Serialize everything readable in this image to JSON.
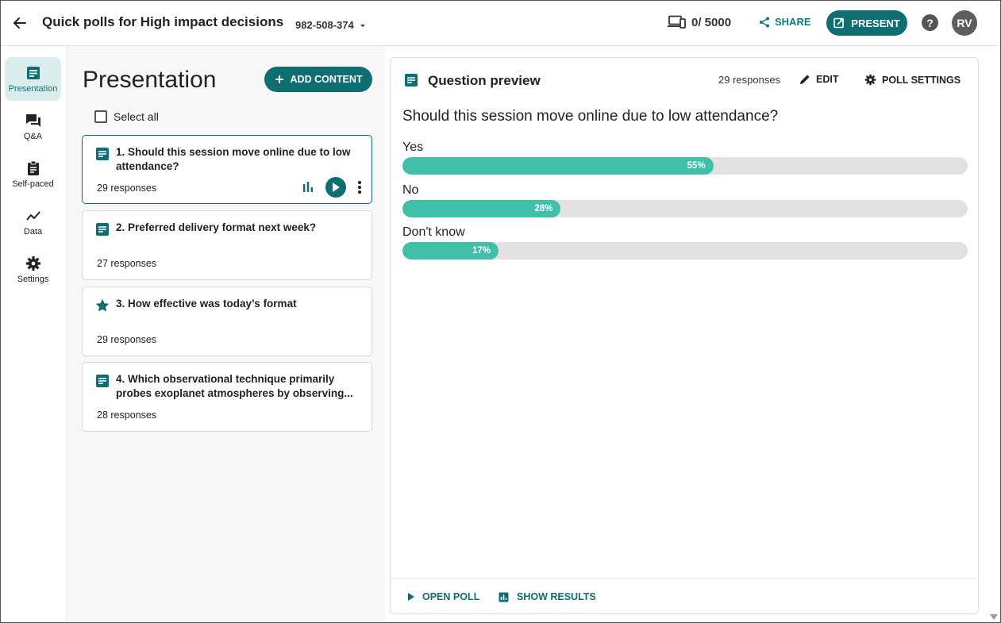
{
  "header": {
    "title": "Quick polls for High impact decisions",
    "session_id": "982-508-374",
    "participants": "0/ 5000",
    "share_label": "SHARE",
    "present_label": "PRESENT",
    "help_label": "?",
    "avatar_initials": "RV"
  },
  "nav": {
    "items": [
      {
        "label": "Presentation",
        "icon": "presentation-icon"
      },
      {
        "label": "Q&A",
        "icon": "chat-icon"
      },
      {
        "label": "Self-paced",
        "icon": "clipboard-icon"
      },
      {
        "label": "Data",
        "icon": "trend-icon"
      },
      {
        "label": "Settings",
        "icon": "gear-icon"
      }
    ]
  },
  "list": {
    "title": "Presentation",
    "add_label": "ADD CONTENT",
    "select_all_label": "Select all",
    "cards": [
      {
        "title": "1. Should this session move online due to low attendance?",
        "responses": "29 responses",
        "icon": "poll-icon"
      },
      {
        "title": "2. Preferred delivery format next week?",
        "responses": "27 responses",
        "icon": "poll-icon"
      },
      {
        "title": "3. How effective was today’s format",
        "responses": "29 responses",
        "icon": "star-icon"
      },
      {
        "title": "4. Which observational technique primarily probes exoplanet atmospheres by observing...",
        "responses": "28 responses",
        "icon": "poll-icon"
      }
    ]
  },
  "preview": {
    "title": "Question preview",
    "responses": "29 responses",
    "edit_label": "EDIT",
    "settings_label": "POLL SETTINGS",
    "question": "Should this session move online due to low attendance?",
    "options": [
      {
        "label": "Yes",
        "percent": 55,
        "percent_label": "55%"
      },
      {
        "label": "No",
        "percent": 28,
        "percent_label": "28%"
      },
      {
        "label": "Don't know",
        "percent": 17,
        "percent_label": "17%"
      }
    ],
    "open_poll_label": "OPEN POLL",
    "show_results_label": "SHOW RESULTS"
  },
  "colors": {
    "accent": "#0f6e72",
    "bar_fill": "#40bfa9",
    "bar_track": "#e2e2e2"
  }
}
